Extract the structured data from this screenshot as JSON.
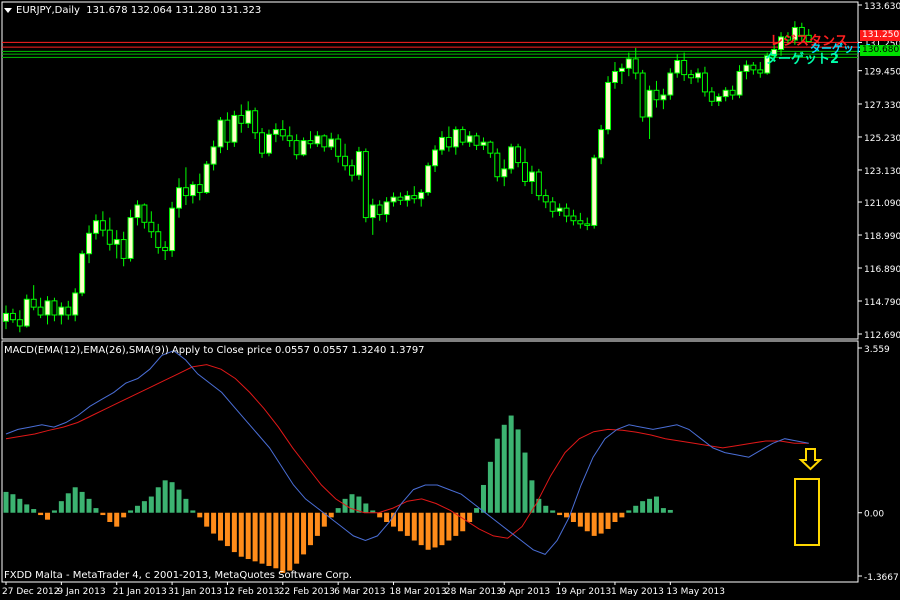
{
  "window": {
    "symbol_title": "EURJPY,Daily",
    "ohlc": "131.678 132.064 131.280 131.323",
    "macd_label": "MACD(EMA(12),EMA(26),SMA(9)) Apply to Close price 0.0557 0.0557 1.3240 1.3797",
    "copyright": "FXDD Malta - MetaTrader 4, c 2001-2013, MetaQuotes Software Corp.",
    "menu_icon": "triangle-down-icon"
  },
  "annotations": {
    "resistance_label": "レジスタンス",
    "target_label": "ターゲット2",
    "target_label_1": "ターゲット1",
    "arrow_icon": "down-arrow-icon"
  },
  "price_tags": {
    "red": "131.250",
    "green": "130.680"
  },
  "colors": {
    "background": "#000000",
    "bull_candle": "#ffffcc",
    "bear_candle": "#000000",
    "wick": "#00ff00",
    "grid_axis": "#ffffff",
    "macd_line": "#4a6ed6",
    "signal_line": "#e01818",
    "hist_positive": "#3cb371",
    "hist_negative": "#ff8c1a",
    "resistance": "#ff2020",
    "support": "#00c000",
    "highlight": "#ffd700"
  },
  "chart_data": [
    {
      "type": "candlestick",
      "symbol": "EURJPY",
      "timeframe": "Daily",
      "ylim": [
        112.69,
        133.63
      ],
      "y_ticks": [
        "133.630",
        "131.250",
        "130.680",
        "129.450",
        "127.330",
        "125.230",
        "123.130",
        "121.090",
        "118.990",
        "116.890",
        "114.790",
        "112.690"
      ],
      "x_ticks": [
        "27 Dec 2012",
        "9 Jan 2013",
        "21 Jan 2013",
        "31 Jan 2013",
        "12 Feb 2013",
        "22 Feb 2013",
        "6 Mar 2013",
        "18 Mar 2013",
        "28 Mar 2013",
        "9 Apr 2013",
        "19 Apr 2013",
        "1 May 2013",
        "13 May 2013"
      ],
      "horizontal_lines": [
        {
          "price": 131.25,
          "color": "red"
        },
        {
          "price": 130.95,
          "color": "red"
        },
        {
          "price": 130.68,
          "color": "green"
        },
        {
          "price": 130.5,
          "color": "green"
        },
        {
          "price": 130.3,
          "color": "green"
        }
      ],
      "candles": [
        [
          113.5,
          114.5,
          113.0,
          114.0
        ],
        [
          114.0,
          114.3,
          113.4,
          113.6
        ],
        [
          113.6,
          114.2,
          112.8,
          113.2
        ],
        [
          113.2,
          115.2,
          113.1,
          114.9
        ],
        [
          114.9,
          115.8,
          114.2,
          114.4
        ],
        [
          114.4,
          115.0,
          113.7,
          113.9
        ],
        [
          113.9,
          115.1,
          113.3,
          114.8
        ],
        [
          114.8,
          115.0,
          113.5,
          113.9
        ],
        [
          113.9,
          114.7,
          113.3,
          114.4
        ],
        [
          114.4,
          114.8,
          113.6,
          113.9
        ],
        [
          113.9,
          115.6,
          113.5,
          115.3
        ],
        [
          115.3,
          118.0,
          115.1,
          117.8
        ],
        [
          117.8,
          119.6,
          117.2,
          119.1
        ],
        [
          119.1,
          120.3,
          118.7,
          119.9
        ],
        [
          119.9,
          120.5,
          118.9,
          119.3
        ],
        [
          119.3,
          120.1,
          118.0,
          118.4
        ],
        [
          118.4,
          119.3,
          117.5,
          118.7
        ],
        [
          118.7,
          119.2,
          117.0,
          117.5
        ],
        [
          117.5,
          120.6,
          117.3,
          120.1
        ],
        [
          120.1,
          121.2,
          119.6,
          120.9
        ],
        [
          120.9,
          121.0,
          119.4,
          119.8
        ],
        [
          119.8,
          120.5,
          118.8,
          119.2
        ],
        [
          119.2,
          119.7,
          117.8,
          118.2
        ],
        [
          118.2,
          118.6,
          117.4,
          118.0
        ],
        [
          118.0,
          121.1,
          117.6,
          120.7
        ],
        [
          120.7,
          122.6,
          120.1,
          122.0
        ],
        [
          122.0,
          123.3,
          120.9,
          121.5
        ],
        [
          121.5,
          122.4,
          121.0,
          122.2
        ],
        [
          122.2,
          122.9,
          121.2,
          121.7
        ],
        [
          121.7,
          123.7,
          121.6,
          123.5
        ],
        [
          123.5,
          125.0,
          123.1,
          124.6
        ],
        [
          124.6,
          126.5,
          124.2,
          126.3
        ],
        [
          126.3,
          126.8,
          124.4,
          124.9
        ],
        [
          124.9,
          126.9,
          124.6,
          126.6
        ],
        [
          126.6,
          127.3,
          125.5,
          126.1
        ],
        [
          126.1,
          127.5,
          125.8,
          126.9
        ],
        [
          126.9,
          127.1,
          125.1,
          125.5
        ],
        [
          125.5,
          125.8,
          123.9,
          124.2
        ],
        [
          124.2,
          125.7,
          124.0,
          125.4
        ],
        [
          125.4,
          126.1,
          124.9,
          125.7
        ],
        [
          125.7,
          126.3,
          125.0,
          125.3
        ],
        [
          125.3,
          125.9,
          124.6,
          125.0
        ],
        [
          125.0,
          125.4,
          123.8,
          124.1
        ],
        [
          124.1,
          125.2,
          124.0,
          125.0
        ],
        [
          125.0,
          125.6,
          124.5,
          124.8
        ],
        [
          124.8,
          125.6,
          124.6,
          125.3
        ],
        [
          125.3,
          125.4,
          124.3,
          124.6
        ],
        [
          124.6,
          125.5,
          124.4,
          125.1
        ],
        [
          125.1,
          125.4,
          123.6,
          124.0
        ],
        [
          124.0,
          124.8,
          123.1,
          123.4
        ],
        [
          123.4,
          123.8,
          122.4,
          122.8
        ],
        [
          122.8,
          124.6,
          122.5,
          124.3
        ],
        [
          124.3,
          124.5,
          119.8,
          120.1
        ],
        [
          120.1,
          121.3,
          119.0,
          120.9
        ],
        [
          120.9,
          121.2,
          119.9,
          120.3
        ],
        [
          120.3,
          121.4,
          119.8,
          121.1
        ],
        [
          121.1,
          121.7,
          120.8,
          121.4
        ],
        [
          121.4,
          121.7,
          120.9,
          121.2
        ],
        [
          121.2,
          121.8,
          120.8,
          121.5
        ],
        [
          121.5,
          122.1,
          121.0,
          121.3
        ],
        [
          121.3,
          121.9,
          120.8,
          121.7
        ],
        [
          121.7,
          123.6,
          121.5,
          123.4
        ],
        [
          123.4,
          124.7,
          123.0,
          124.4
        ],
        [
          124.4,
          125.6,
          124.1,
          125.2
        ],
        [
          125.2,
          125.9,
          124.3,
          124.6
        ],
        [
          124.6,
          125.9,
          124.1,
          125.7
        ],
        [
          125.7,
          125.9,
          124.7,
          124.9
        ],
        [
          124.9,
          125.6,
          124.6,
          125.3
        ],
        [
          125.3,
          125.5,
          124.4,
          124.7
        ],
        [
          124.7,
          125.2,
          124.4,
          124.9
        ],
        [
          124.9,
          125.0,
          123.9,
          124.2
        ],
        [
          124.2,
          124.5,
          122.4,
          122.7
        ],
        [
          122.7,
          123.8,
          122.1,
          123.2
        ],
        [
          123.2,
          124.8,
          122.9,
          124.6
        ],
        [
          124.6,
          124.8,
          123.3,
          123.6
        ],
        [
          123.6,
          124.5,
          122.1,
          122.4
        ],
        [
          122.4,
          123.4,
          121.6,
          123.0
        ],
        [
          123.0,
          123.2,
          121.2,
          121.5
        ],
        [
          121.5,
          121.9,
          120.7,
          121.1
        ],
        [
          121.1,
          121.4,
          120.1,
          120.5
        ],
        [
          120.5,
          121.0,
          120.2,
          120.7
        ],
        [
          120.7,
          121.0,
          119.8,
          120.2
        ],
        [
          120.2,
          120.6,
          119.6,
          119.9
        ],
        [
          119.9,
          120.4,
          119.4,
          119.7
        ],
        [
          119.7,
          120.1,
          119.3,
          119.6
        ],
        [
          119.6,
          124.1,
          119.4,
          123.9
        ],
        [
          123.9,
          126.0,
          123.5,
          125.7
        ],
        [
          125.7,
          129.1,
          125.4,
          128.7
        ],
        [
          128.7,
          130.0,
          128.3,
          129.4
        ],
        [
          129.4,
          129.9,
          128.6,
          129.6
        ],
        [
          129.6,
          130.6,
          129.1,
          130.2
        ],
        [
          130.2,
          130.9,
          128.9,
          129.3
        ],
        [
          129.3,
          129.5,
          126.2,
          126.5
        ],
        [
          126.5,
          128.5,
          125.1,
          128.2
        ],
        [
          128.2,
          128.8,
          127.1,
          127.6
        ],
        [
          127.6,
          128.3,
          127.0,
          127.9
        ],
        [
          127.9,
          129.6,
          127.6,
          129.3
        ],
        [
          129.3,
          130.5,
          129.0,
          130.1
        ],
        [
          130.1,
          130.6,
          128.8,
          129.2
        ],
        [
          129.2,
          129.5,
          128.6,
          129.0
        ],
        [
          129.0,
          129.6,
          128.7,
          129.3
        ],
        [
          129.3,
          129.7,
          127.8,
          128.1
        ],
        [
          128.1,
          128.4,
          127.2,
          127.5
        ],
        [
          127.5,
          128.0,
          127.2,
          127.8
        ],
        [
          127.8,
          128.4,
          127.5,
          128.2
        ],
        [
          128.2,
          128.5,
          127.6,
          127.9
        ],
        [
          127.9,
          129.8,
          127.7,
          129.4
        ],
        [
          129.4,
          130.1,
          128.9,
          129.8
        ],
        [
          129.8,
          130.0,
          129.2,
          129.5
        ],
        [
          129.5,
          130.0,
          129.0,
          129.3
        ],
        [
          129.3,
          130.6,
          129.2,
          130.4
        ],
        [
          130.4,
          131.2,
          130.0,
          130.8
        ],
        [
          130.8,
          131.9,
          130.4,
          131.6
        ],
        [
          131.6,
          131.9,
          131.1,
          131.4
        ],
        [
          131.4,
          132.6,
          131.1,
          132.2
        ],
        [
          132.2,
          132.5,
          131.3,
          131.7
        ],
        [
          131.7,
          132.1,
          131.3,
          131.3
        ]
      ]
    },
    {
      "type": "bar",
      "indicator": "MACD(EMA(12),EMA(26),SMA(9))",
      "ylim": [
        -1.3667,
        3.559
      ],
      "y_ticks": [
        "3.559",
        "0.00",
        "-1.3667"
      ],
      "histogram": [
        0.45,
        0.4,
        0.3,
        0.18,
        0.08,
        -0.05,
        -0.15,
        0.05,
        0.25,
        0.42,
        0.55,
        0.45,
        0.3,
        0.1,
        -0.05,
        -0.2,
        -0.3,
        -0.1,
        0.05,
        0.15,
        0.25,
        0.35,
        0.55,
        0.7,
        0.66,
        0.5,
        0.3,
        0.05,
        -0.1,
        -0.3,
        -0.45,
        -0.6,
        -0.72,
        -0.85,
        -0.95,
        -1.0,
        -1.05,
        -1.1,
        -1.15,
        -1.2,
        -1.3,
        -1.25,
        -1.1,
        -0.9,
        -0.7,
        -0.5,
        -0.3,
        -0.1,
        0.1,
        0.3,
        0.4,
        0.35,
        0.2,
        0.05,
        -0.1,
        -0.2,
        -0.3,
        -0.4,
        -0.5,
        -0.6,
        -0.7,
        -0.8,
        -0.75,
        -0.7,
        -0.6,
        -0.5,
        -0.4,
        -0.2,
        0.1,
        0.6,
        1.1,
        1.6,
        1.9,
        2.1,
        1.8,
        1.3,
        0.7,
        0.3,
        0.15,
        0.05,
        -0.05,
        -0.1,
        -0.2,
        -0.3,
        -0.4,
        -0.5,
        -0.45,
        -0.35,
        -0.2,
        -0.1,
        0.05,
        0.15,
        0.25,
        0.3,
        0.35,
        0.1,
        0.06
      ],
      "macd_line": [
        1.7,
        1.8,
        1.85,
        1.9,
        1.85,
        1.95,
        2.1,
        2.3,
        2.45,
        2.6,
        2.8,
        2.9,
        3.1,
        3.4,
        3.5,
        3.3,
        3.0,
        2.8,
        2.6,
        2.3,
        2.0,
        1.7,
        1.4,
        1.0,
        0.6,
        0.3,
        0.1,
        -0.1,
        -0.3,
        -0.5,
        -0.6,
        -0.5,
        -0.2,
        0.2,
        0.5,
        0.6,
        0.6,
        0.5,
        0.4,
        0.2,
        0.0,
        -0.2,
        -0.4,
        -0.6,
        -0.8,
        -0.9,
        -0.6,
        -0.1,
        0.6,
        1.2,
        1.6,
        1.8,
        1.9,
        1.85,
        1.8,
        1.85,
        1.9,
        1.8,
        1.6,
        1.4,
        1.3,
        1.25,
        1.2,
        1.35,
        1.5,
        1.6,
        1.55,
        1.5
      ],
      "signal_line": [
        1.6,
        1.65,
        1.7,
        1.78,
        1.85,
        1.95,
        2.1,
        2.25,
        2.4,
        2.55,
        2.7,
        2.85,
        3.0,
        3.15,
        3.2,
        3.1,
        2.9,
        2.6,
        2.25,
        1.85,
        1.4,
        1.0,
        0.6,
        0.3,
        0.1,
        0.0,
        0.0,
        0.1,
        0.25,
        0.3,
        0.2,
        0.05,
        -0.15,
        -0.35,
        -0.5,
        -0.55,
        -0.3,
        0.2,
        0.8,
        1.3,
        1.6,
        1.75,
        1.8,
        1.78,
        1.74,
        1.68,
        1.6,
        1.55,
        1.5,
        1.45,
        1.4,
        1.45,
        1.5,
        1.55,
        1.55,
        1.5,
        1.5
      ]
    }
  ]
}
